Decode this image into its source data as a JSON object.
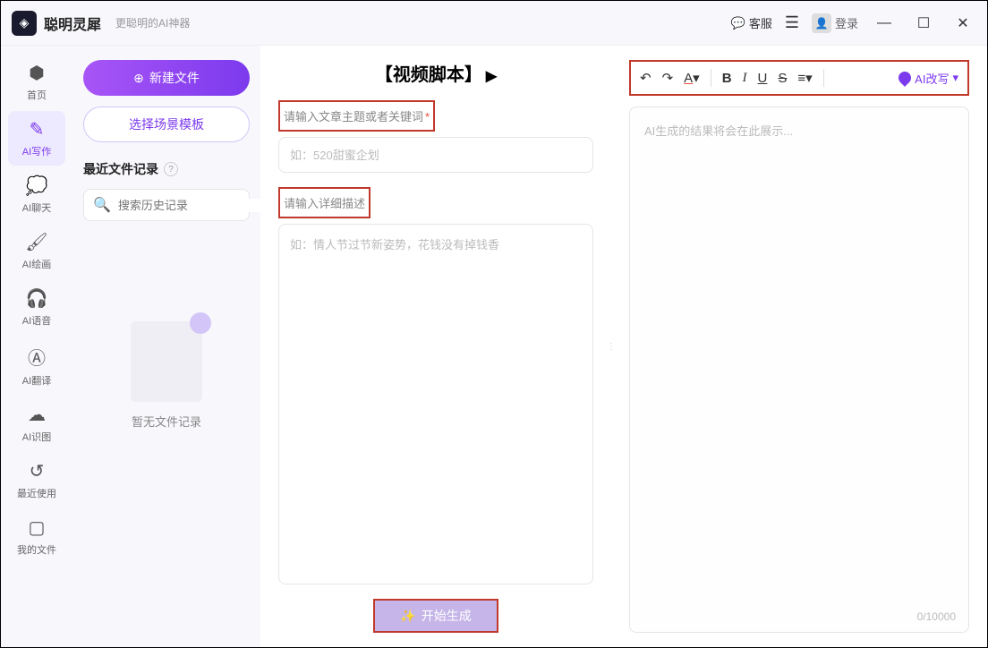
{
  "header": {
    "app_name": "聪明灵犀",
    "subtitle": "更聪明的AI神器",
    "kefu": "客服",
    "login": "登录"
  },
  "sidebar": {
    "items": [
      {
        "label": "首页"
      },
      {
        "label": "AI写作"
      },
      {
        "label": "AI聊天"
      },
      {
        "label": "AI绘画"
      },
      {
        "label": "AI语音"
      },
      {
        "label": "AI翻译"
      },
      {
        "label": "AI识图"
      },
      {
        "label": "最近使用"
      },
      {
        "label": "我的文件"
      }
    ]
  },
  "left_panel": {
    "new_file": "新建文件",
    "template": "选择场景模板",
    "recent_title": "最近文件记录",
    "search_placeholder": "搜索历史记录",
    "empty_text": "暂无文件记录"
  },
  "center": {
    "title": "【视频脚本】",
    "topic_label": "请输入文章主题或者关键词",
    "topic_placeholder": "如：520甜蜜企划",
    "desc_label": "请输入详细描述",
    "desc_placeholder": "如：情人节过节新姿势，花钱没有掉钱香",
    "generate": "开始生成"
  },
  "right": {
    "ai_rewrite": "AI改写",
    "output_placeholder": "AI生成的结果将会在此展示...",
    "char_count": "0/10000"
  }
}
